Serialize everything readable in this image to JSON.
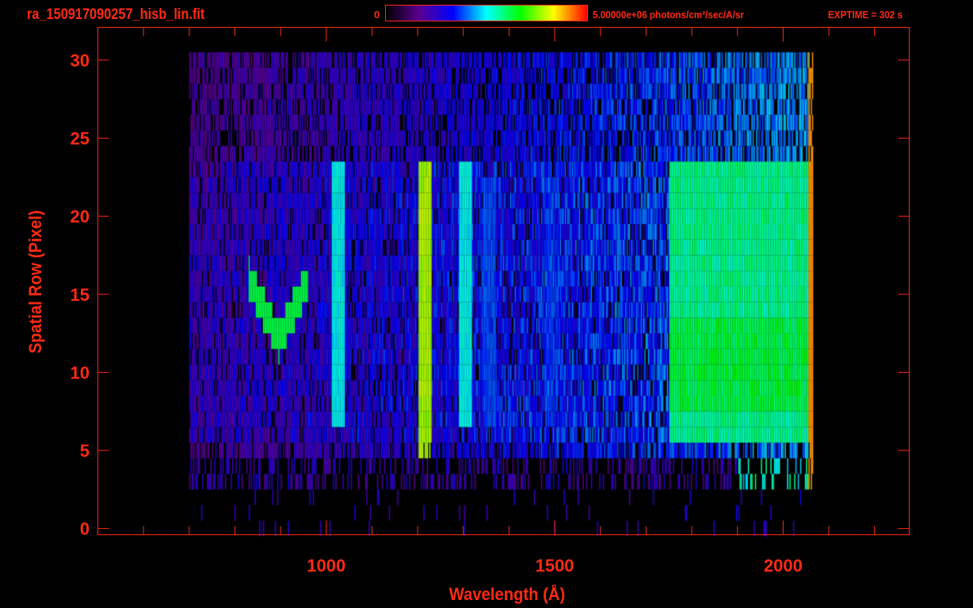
{
  "header": {
    "title": "ra_150917090257_hisb_lin.fit",
    "colorbar_min": "0",
    "colorbar_max": "5.00000e+06 photons/cm²/sec/A/sr",
    "exptime": "EXPTIME = 302 s"
  },
  "colors": {
    "axis": "#ff2a12",
    "background": "#000000"
  },
  "chart_data": {
    "type": "heatmap",
    "title": "ra_150917090257_hisb_lin.fit",
    "xlabel": "Wavelength (Å)",
    "ylabel": "Spatial Row (Pixel)",
    "xlim": [
      500,
      2276
    ],
    "ylim": [
      -0.4,
      32.1
    ],
    "xticks": [
      {
        "value": 1000,
        "label": "1000"
      },
      {
        "value": 1500,
        "label": "1500"
      },
      {
        "value": 2000,
        "label": "2000"
      }
    ],
    "yticks": [
      {
        "value": 0,
        "label": "0"
      },
      {
        "value": 5,
        "label": "5"
      },
      {
        "value": 10,
        "label": "10"
      },
      {
        "value": 15,
        "label": "15"
      },
      {
        "value": 20,
        "label": "20"
      },
      {
        "value": 25,
        "label": "25"
      },
      {
        "value": 30,
        "label": "30"
      }
    ],
    "colorscale": {
      "min": 0,
      "max": 5000000,
      "units": "photons/cm2/sec/A/sr",
      "colors": [
        "#000000",
        "#5a0090",
        "#0000ff",
        "#00ffff",
        "#00ff00",
        "#ffff00",
        "#ff0000"
      ]
    },
    "data_extent": {
      "wavelength": [
        700,
        2065
      ],
      "rows": [
        0,
        30
      ],
      "bright_rows": [
        6,
        23
      ]
    },
    "emission_features": [
      {
        "wavelength": 1025,
        "rows": [
          7,
          23
        ],
        "level": 0.5
      },
      {
        "wavelength": 1216,
        "rows": [
          5,
          23
        ],
        "level": 0.78
      },
      {
        "wavelength": 1304,
        "rows": [
          7,
          23
        ],
        "level": 0.5
      },
      {
        "wavelength": 1356,
        "rows": [
          7,
          22
        ],
        "level": 0.38
      },
      {
        "wavelength": 1490,
        "rows": [
          8,
          22
        ],
        "level": 0.35
      }
    ],
    "continuum": {
      "wavelength": [
        1750,
        2065
      ],
      "rows": [
        6,
        23
      ],
      "level": 0.62
    },
    "arc_feature": {
      "wavelength": [
        830,
        960
      ],
      "rows": [
        11,
        16
      ],
      "level": 0.62
    }
  }
}
